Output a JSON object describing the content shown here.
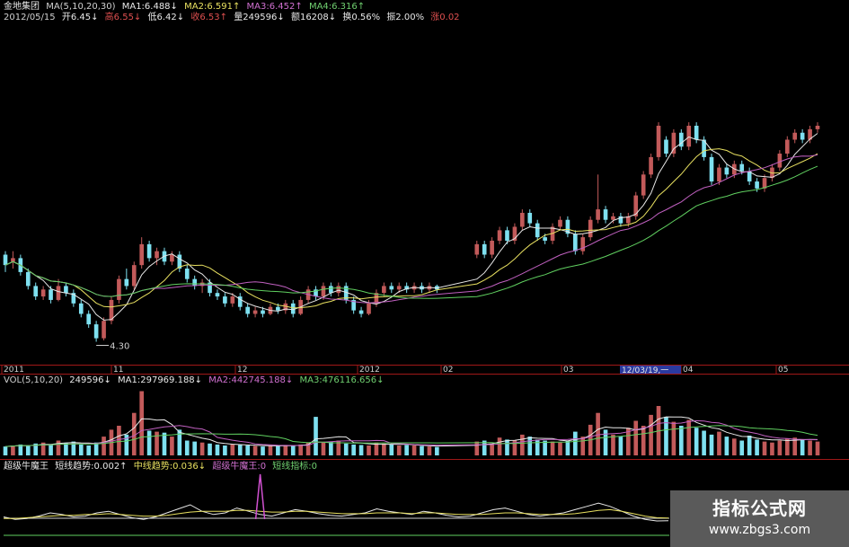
{
  "header": {
    "stock_name": "金地集团",
    "ma_params": "MA(5,10,20,30)",
    "ma1": "MA1:6.488↓",
    "ma2": "MA2:6.591↑",
    "ma3": "MA3:6.452↑",
    "ma4": "MA4:6.316↑",
    "date": "2012/05/15",
    "open": "开6.45↓",
    "high": "高6.55↓",
    "low": "低6.42↓",
    "close": "收6.53↑",
    "volume": "量249596↓",
    "amount": "额16208↓",
    "turnover": "换0.56%",
    "amplitude": "振2.00%",
    "change": "涨0.02"
  },
  "volume_header": {
    "params": "VOL(5,10,20)",
    "vol": "249596↓",
    "ma1": "MA1:297969.188↓",
    "ma2": "MA2:442745.188↓",
    "ma3": "MA3:476116.656↓"
  },
  "indicator_header": {
    "name": "超级牛魔王",
    "short": "短线趋势:0.002↑",
    "mid": "中线趋势:0.036↓",
    "super": "超级牛魔王:0",
    "short_ind": "短线指标:0"
  },
  "cursor_date_label": "12/03/19,一",
  "low_label": "4.30",
  "watermark": {
    "title": "指标公式网",
    "url": "www.zbgs3.com"
  },
  "colors": {
    "up": "#c25a5a",
    "down": "#7ee0f0",
    "ma_white": "#e8e8e8",
    "ma_yellow": "#e8e060",
    "ma_magenta": "#c060c0",
    "ma_green": "#60d060",
    "grid": "#a01818"
  },
  "chart_data": [
    {
      "type": "candlestick",
      "title": "金地集团",
      "x_ticks": [
        "2011",
        "11",
        "12",
        "2012",
        "02",
        "03",
        "04",
        "05"
      ],
      "ylim": [
        4.1,
        7.4
      ],
      "low_marker": 4.3,
      "ohlc": [
        [
          5.55,
          5.4,
          5.6,
          5.3
        ],
        [
          5.45,
          5.5,
          5.6,
          5.35
        ],
        [
          5.5,
          5.3,
          5.55,
          5.25
        ],
        [
          5.3,
          5.1,
          5.35,
          5.05
        ],
        [
          5.1,
          4.95,
          5.15,
          4.9
        ],
        [
          4.95,
          5.05,
          5.1,
          4.9
        ],
        [
          5.05,
          4.9,
          5.1,
          4.85
        ],
        [
          4.9,
          5.1,
          5.2,
          4.88
        ],
        [
          5.1,
          5.0,
          5.15,
          4.95
        ],
        [
          5.0,
          4.85,
          5.05,
          4.8
        ],
        [
          4.85,
          4.7,
          4.9,
          4.65
        ],
        [
          4.7,
          4.55,
          4.75,
          4.5
        ],
        [
          4.55,
          4.35,
          4.6,
          4.3
        ],
        [
          4.35,
          4.6,
          4.65,
          4.32
        ],
        [
          4.6,
          4.9,
          4.95,
          4.55
        ],
        [
          4.9,
          5.2,
          5.25,
          4.85
        ],
        [
          5.2,
          5.1,
          5.35,
          5.05
        ],
        [
          5.1,
          5.4,
          5.45,
          5.05
        ],
        [
          5.4,
          5.7,
          5.8,
          5.35
        ],
        [
          5.7,
          5.5,
          5.75,
          5.45
        ],
        [
          5.5,
          5.6,
          5.65,
          5.4
        ],
        [
          5.6,
          5.45,
          5.65,
          5.4
        ],
        [
          5.45,
          5.55,
          5.6,
          5.4
        ],
        [
          5.55,
          5.35,
          5.6,
          5.3
        ],
        [
          5.35,
          5.2,
          5.4,
          5.15
        ],
        [
          5.2,
          5.1,
          5.25,
          5.05
        ],
        [
          5.1,
          5.15,
          5.2,
          5.0
        ],
        [
          5.15,
          5.0,
          5.2,
          4.95
        ],
        [
          5.0,
          4.95,
          5.05,
          4.9
        ],
        [
          4.95,
          4.85,
          5.0,
          4.8
        ],
        [
          4.85,
          4.95,
          5.0,
          4.8
        ],
        [
          4.95,
          4.8,
          5.0,
          4.75
        ],
        [
          4.8,
          4.7,
          4.85,
          4.65
        ],
        [
          4.7,
          4.75,
          4.8,
          4.65
        ],
        [
          4.75,
          4.7,
          4.8,
          4.65
        ],
        [
          4.7,
          4.8,
          4.85,
          4.68
        ],
        [
          4.8,
          4.75,
          4.85,
          4.7
        ],
        [
          4.75,
          4.85,
          4.9,
          4.7
        ],
        [
          4.85,
          4.7,
          4.9,
          4.65
        ],
        [
          4.7,
          4.9,
          4.95,
          4.68
        ],
        [
          4.9,
          5.05,
          5.1,
          4.85
        ],
        [
          5.05,
          4.95,
          5.1,
          4.9
        ],
        [
          4.95,
          5.1,
          5.15,
          4.9
        ],
        [
          5.1,
          5.0,
          5.15,
          4.95
        ],
        [
          5.0,
          5.1,
          5.15,
          4.95
        ],
        [
          5.1,
          4.9,
          5.15,
          4.85
        ],
        [
          4.9,
          4.75,
          4.95,
          4.7
        ],
        [
          4.75,
          4.7,
          4.8,
          4.65
        ],
        [
          4.7,
          4.85,
          4.9,
          4.68
        ],
        [
          4.85,
          5.0,
          5.05,
          4.8
        ],
        [
          5.0,
          5.1,
          5.15,
          4.95
        ],
        [
          5.1,
          5.05,
          5.15,
          5.0
        ],
        [
          5.05,
          5.1,
          5.15,
          5.0
        ],
        [
          5.1,
          5.05,
          5.15,
          5.0
        ],
        [
          5.05,
          5.1,
          5.15,
          5.0
        ],
        [
          5.1,
          5.05,
          5.15,
          5.0
        ],
        [
          5.05,
          5.1,
          5.15,
          5.0
        ],
        [
          5.1,
          5.05,
          5.12,
          5.0
        ],
        [
          5.55,
          5.7,
          5.75,
          5.5
        ],
        [
          5.7,
          5.55,
          5.75,
          5.5
        ],
        [
          5.55,
          5.75,
          5.8,
          5.5
        ],
        [
          5.75,
          5.9,
          5.95,
          5.7
        ],
        [
          5.9,
          5.75,
          5.95,
          5.7
        ],
        [
          5.75,
          5.95,
          6.0,
          5.7
        ],
        [
          5.95,
          6.15,
          6.2,
          5.9
        ],
        [
          6.15,
          6.0,
          6.2,
          5.95
        ],
        [
          6.0,
          5.8,
          6.05,
          5.75
        ],
        [
          5.8,
          5.75,
          5.85,
          5.7
        ],
        [
          5.75,
          5.95,
          6.0,
          5.7
        ],
        [
          5.95,
          6.05,
          6.1,
          5.9
        ],
        [
          6.05,
          5.85,
          6.1,
          5.8
        ],
        [
          5.85,
          5.6,
          5.9,
          5.55
        ],
        [
          5.6,
          5.8,
          5.85,
          5.55
        ],
        [
          5.8,
          6.05,
          6.1,
          5.75
        ],
        [
          6.05,
          6.2,
          6.7,
          6.0
        ],
        [
          6.2,
          6.05,
          6.25,
          6.0
        ],
        [
          6.05,
          6.1,
          6.15,
          6.0
        ],
        [
          6.1,
          6.0,
          6.15,
          5.95
        ],
        [
          6.0,
          6.1,
          6.15,
          5.95
        ],
        [
          6.1,
          6.4,
          6.45,
          6.05
        ],
        [
          6.4,
          6.7,
          6.75,
          6.35
        ],
        [
          6.7,
          6.95,
          7.0,
          6.65
        ],
        [
          6.95,
          7.4,
          7.45,
          6.9
        ],
        [
          7.2,
          7.0,
          7.25,
          6.95
        ],
        [
          7.0,
          7.3,
          7.35,
          6.95
        ],
        [
          7.3,
          7.1,
          7.35,
          7.05
        ],
        [
          7.1,
          7.4,
          7.45,
          7.05
        ],
        [
          7.4,
          7.2,
          7.45,
          7.15
        ],
        [
          7.2,
          6.95,
          7.25,
          6.9
        ],
        [
          6.95,
          6.6,
          7.0,
          6.55
        ],
        [
          6.6,
          6.8,
          6.85,
          6.55
        ],
        [
          6.8,
          6.7,
          6.85,
          6.65
        ],
        [
          6.7,
          6.85,
          6.9,
          6.65
        ],
        [
          6.85,
          6.75,
          6.9,
          6.7
        ],
        [
          6.75,
          6.6,
          6.8,
          6.55
        ],
        [
          6.6,
          6.5,
          6.65,
          6.45
        ],
        [
          6.5,
          6.65,
          6.7,
          6.45
        ],
        [
          6.65,
          6.8,
          6.85,
          6.6
        ],
        [
          6.8,
          7.0,
          7.05,
          6.75
        ],
        [
          7.0,
          7.2,
          7.25,
          6.95
        ],
        [
          7.2,
          7.3,
          7.35,
          7.15
        ],
        [
          7.3,
          7.2,
          7.35,
          7.15
        ],
        [
          7.2,
          7.35,
          7.4,
          7.15
        ],
        [
          7.35,
          7.4,
          7.45,
          7.3
        ]
      ],
      "gap_after_index": 57,
      "ma_lines": [
        {
          "name": "MA1",
          "color_key": "ma_white",
          "period": 5
        },
        {
          "name": "MA2",
          "color_key": "ma_yellow",
          "period": 10
        },
        {
          "name": "MA3",
          "color_key": "ma_magenta",
          "period": 20
        },
        {
          "name": "MA4",
          "color_key": "ma_green",
          "period": 30
        }
      ]
    },
    {
      "type": "bar",
      "title": "VOL(5,10,20)",
      "ylim": [
        0,
        1400000
      ],
      "values": [
        180000,
        200000,
        220000,
        190000,
        240000,
        260000,
        210000,
        300000,
        250000,
        280000,
        220000,
        200000,
        260000,
        380000,
        520000,
        600000,
        420000,
        860000,
        1300000,
        500000,
        480000,
        460000,
        380000,
        520000,
        300000,
        280000,
        260000,
        240000,
        220000,
        200000,
        220000,
        210000,
        200000,
        190000,
        180000,
        200000,
        190000,
        210000,
        200000,
        220000,
        260000,
        780000,
        260000,
        280000,
        300000,
        240000,
        220000,
        210000,
        200000,
        260000,
        240000,
        220000,
        200000,
        210000,
        200000,
        190000,
        180000,
        170000,
        280000,
        300000,
        240000,
        360000,
        320000,
        300000,
        420000,
        380000,
        320000,
        300000,
        280000,
        260000,
        300000,
        480000,
        380000,
        620000,
        860000,
        520000,
        420000,
        380000,
        560000,
        700000,
        600000,
        820000,
        1000000,
        780000,
        680000,
        600000,
        720000,
        560000,
        500000,
        420000,
        480000,
        380000,
        340000,
        300000,
        400000,
        320000,
        280000,
        260000,
        300000,
        340000,
        360000,
        320000,
        300000,
        280000
      ]
    },
    {
      "type": "line",
      "title": "超级牛魔王",
      "series": [
        {
          "name": "短线趋势",
          "values": [
            0.05,
            0.02,
            0.03,
            0.06,
            0.1,
            0.08,
            0.05,
            0.06,
            0.1,
            0.12,
            0.08,
            0.04,
            0.02,
            0.05,
            0.1,
            0.15,
            0.2,
            0.12,
            0.08,
            0.1,
            0.16,
            0.12,
            0.08,
            0.06,
            0.1,
            0.14,
            0.12,
            0.09,
            0.07,
            0.06,
            0.08,
            0.1,
            0.15,
            0.12,
            0.1,
            0.08,
            0.12,
            0.1,
            0.07,
            0.05,
            0.06,
            0.1,
            0.14,
            0.16,
            0.12,
            0.08,
            0.06,
            0.08,
            0.1,
            0.14,
            0.18,
            0.22,
            0.18,
            0.12,
            0.06,
            0.02,
            0.0,
            0.002
          ]
        },
        {
          "name": "中线趋势",
          "values": [
            0.03,
            0.03,
            0.04,
            0.05,
            0.06,
            0.07,
            0.07,
            0.08,
            0.08,
            0.09,
            0.08,
            0.07,
            0.06,
            0.06,
            0.07,
            0.09,
            0.11,
            0.12,
            0.12,
            0.12,
            0.13,
            0.13,
            0.12,
            0.11,
            0.11,
            0.12,
            0.12,
            0.11,
            0.1,
            0.09,
            0.09,
            0.09,
            0.1,
            0.1,
            0.1,
            0.09,
            0.1,
            0.1,
            0.09,
            0.08,
            0.08,
            0.08,
            0.09,
            0.1,
            0.1,
            0.09,
            0.08,
            0.08,
            0.08,
            0.09,
            0.11,
            0.13,
            0.14,
            0.12,
            0.09,
            0.06,
            0.04,
            0.036
          ]
        },
        {
          "name": "超级牛魔王",
          "values": [
            0,
            0,
            0,
            0,
            0,
            0,
            0,
            0,
            0,
            0,
            0,
            0,
            0,
            0,
            0,
            0,
            0,
            0,
            0,
            0,
            0,
            0,
            1,
            0,
            0,
            0,
            0,
            0,
            0,
            0,
            0,
            0,
            0,
            0,
            0,
            0,
            0,
            0,
            0,
            0,
            0,
            0,
            0,
            0,
            0,
            0,
            0,
            0,
            0,
            0,
            0,
            0,
            0,
            0,
            0,
            0,
            0,
            0
          ]
        },
        {
          "name": "短线指标",
          "values": [
            0,
            0,
            0,
            0,
            0,
            0,
            0,
            0,
            0,
            0,
            0,
            0,
            0,
            0,
            0,
            0,
            0,
            0,
            0,
            0,
            0,
            0,
            0,
            0,
            0,
            0,
            0,
            0,
            0,
            0,
            0,
            0,
            0,
            0,
            0,
            0,
            0,
            0,
            0,
            0,
            0,
            0,
            0,
            0,
            0,
            0,
            0,
            0,
            0,
            0,
            0,
            0,
            0,
            0,
            0,
            0,
            0,
            0
          ]
        }
      ]
    }
  ]
}
